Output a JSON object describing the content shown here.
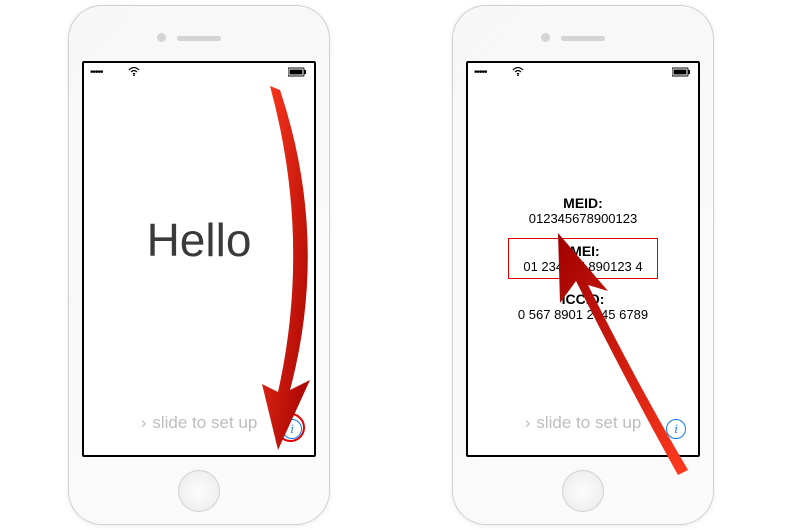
{
  "left": {
    "greeting": "Hello",
    "slide_label": "slide to set up",
    "info_glyph": "i",
    "status": {
      "signal": "•••••",
      "wifi": "◴",
      "battery": "▬"
    }
  },
  "right": {
    "ids": {
      "meid_label": "MEID:",
      "meid_value": "012345678900123",
      "imei_label": "IMEI:",
      "imei_value": "01 234567 890123 4",
      "iccid_label": "ICCID:",
      "iccid_value": "0        567 8901 2345 6789"
    },
    "slide_label": "slide to set up",
    "info_glyph": "i",
    "status": {
      "signal": "•••••",
      "wifi": "◴",
      "battery": "▬"
    }
  },
  "annotation": {
    "arrow_color": "#cc0000",
    "highlight_color": "#e00000"
  }
}
